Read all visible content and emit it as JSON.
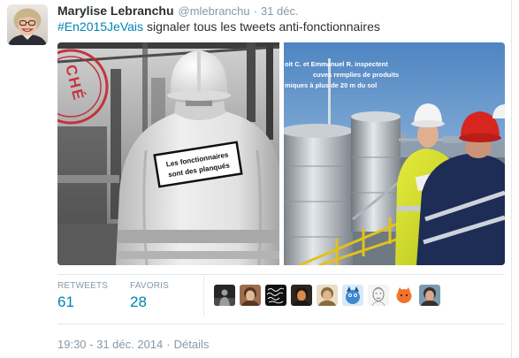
{
  "tweet": {
    "author": {
      "name": "Marylise Lebranchu",
      "handle": "@mlebranchu",
      "avatar_icon": "profile-photo-icon"
    },
    "header_separator": "·",
    "date": "31 déc.",
    "hashtag": "#En2015JeVais",
    "text": "signaler tous les tweets anti-fonctionnaires",
    "media": [
      {
        "stamp_text": "CHÉ",
        "sticker_lines": [
          "Les fonctionnaires",
          "sont des planqués"
        ]
      },
      {
        "caption_lines": [
          "oit C. et Emmanuel R. inspectent",
          "cuves remplies de produits",
          "miques à plus de 20 m du sol"
        ]
      }
    ],
    "stats": [
      {
        "label": "RETWEETS",
        "value": "61"
      },
      {
        "label": "FAVORIS",
        "value": "28"
      }
    ],
    "favoriters": [
      {
        "icon": "dark-photo-avatar-icon",
        "bg": "#262626",
        "fg": "#9c9c9c",
        "accent": "#4a4a4a"
      },
      {
        "icon": "portrait-avatar-icon",
        "bg": "#9c6e4e",
        "fg": "#e2b998",
        "accent": "#5a3522"
      },
      {
        "icon": "handwriting-avatar-icon",
        "bg": "#111111",
        "fg": "#ffffff",
        "accent": "#bbbbbb"
      },
      {
        "icon": "portrait-avatar-icon",
        "bg": "#2f2520",
        "fg": "#d98a4c",
        "accent": "#1d1815"
      },
      {
        "icon": "portrait-avatar-icon",
        "bg": "#e8dec8",
        "fg": "#e2b68b",
        "accent": "#8a6a3e"
      },
      {
        "icon": "cartoon-avatar-icon",
        "bg": "#d8eaf7",
        "fg": "#3d86d1",
        "accent": "#1f4f86"
      },
      {
        "icon": "sketch-avatar-icon",
        "bg": "#f4f4f4",
        "fg": "#666666",
        "accent": "#999999"
      },
      {
        "icon": "orange-face-avatar-icon",
        "bg": "#ffffff",
        "fg": "#f3732a",
        "accent": "#3a2212"
      },
      {
        "icon": "portrait-avatar-icon",
        "bg": "#7b9bb3",
        "fg": "#d7a98a",
        "accent": "#3a3028"
      }
    ],
    "timestamp": "19:30 - 31 déc. 2014",
    "timestamp_separator": "·",
    "details_label": "Détails"
  },
  "colors": {
    "link": "#0084b4",
    "text": "#292f33",
    "muted": "#8899a6",
    "divider": "#e1e8ed"
  }
}
